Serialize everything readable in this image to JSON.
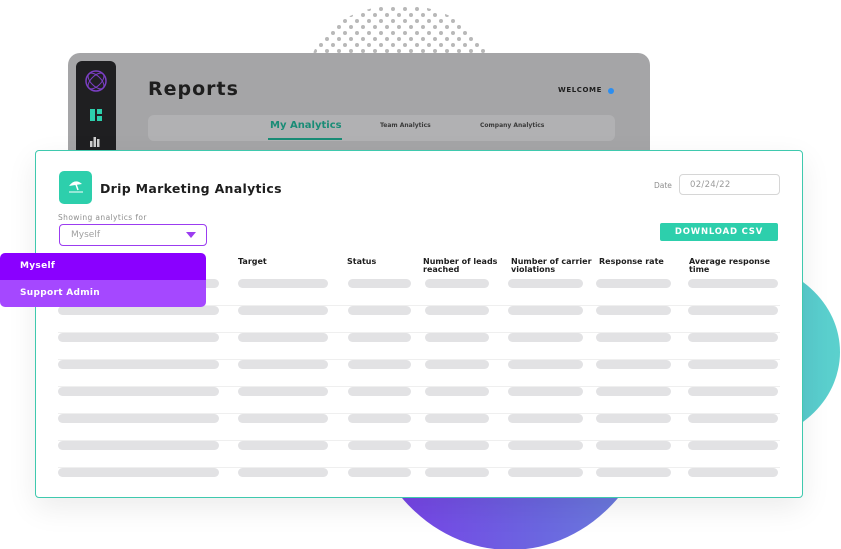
{
  "colors": {
    "accent": "#2dcfac",
    "active_tab": "#1a8c76",
    "select_border": "#9b3cf0",
    "dropdown_primary": "#8a00ff",
    "dropdown_secondary": "#a548ff",
    "welcome_dot": "#2c8ef0"
  },
  "background_window": {
    "title": "Reports",
    "welcome_label": "WELCOME",
    "sidebar_icons": [
      "logo-icon",
      "dashboard-icon",
      "bar-chart-icon"
    ],
    "tabs": [
      {
        "label": "My Analytics",
        "active": true
      },
      {
        "label": "Team Analytics",
        "active": false
      },
      {
        "label": "Company Analytics",
        "active": false
      }
    ]
  },
  "card": {
    "icon": "beach-umbrella-icon",
    "title": "Drip Marketing Analytics",
    "showing_label": "Showing analytics for",
    "select_value": "Myself",
    "date_label": "Date",
    "date_value": "02/24/22",
    "download_label": "DOWNLOAD CSV",
    "columns": [
      {
        "label": ""
      },
      {
        "label": "Target"
      },
      {
        "label": "Status"
      },
      {
        "label": "Number of leads reached"
      },
      {
        "label": "Number of carrier violations"
      },
      {
        "label": "Response rate"
      },
      {
        "label": "Average response time"
      }
    ],
    "row_count": 8,
    "rows_state": "loading-placeholders"
  },
  "dropdown": {
    "options": [
      {
        "label": "Myself",
        "selected": true
      },
      {
        "label": "Support Admin",
        "selected": false
      }
    ]
  }
}
